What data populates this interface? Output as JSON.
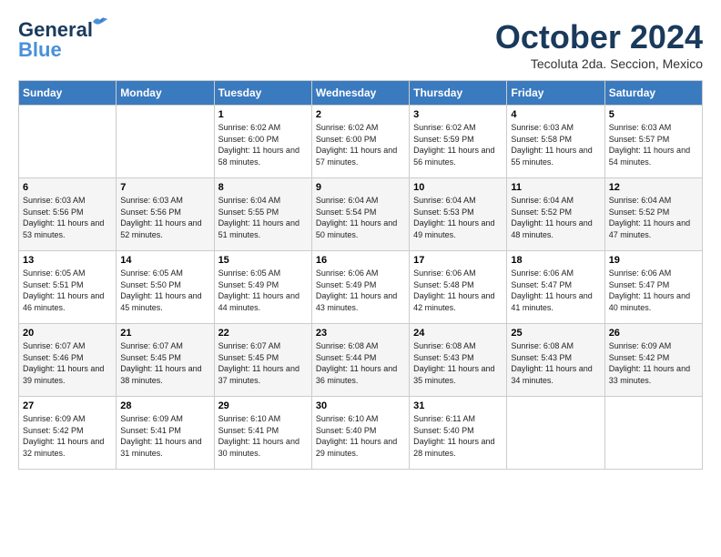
{
  "logo": {
    "general": "General",
    "blue": "Blue"
  },
  "title": "October 2024",
  "location": "Tecoluta 2da. Seccion, Mexico",
  "days_of_week": [
    "Sunday",
    "Monday",
    "Tuesday",
    "Wednesday",
    "Thursday",
    "Friday",
    "Saturday"
  ],
  "weeks": [
    [
      {
        "day": "",
        "sunrise": "",
        "sunset": "",
        "daylight": ""
      },
      {
        "day": "",
        "sunrise": "",
        "sunset": "",
        "daylight": ""
      },
      {
        "day": "1",
        "sunrise": "Sunrise: 6:02 AM",
        "sunset": "Sunset: 6:00 PM",
        "daylight": "Daylight: 11 hours and 58 minutes."
      },
      {
        "day": "2",
        "sunrise": "Sunrise: 6:02 AM",
        "sunset": "Sunset: 6:00 PM",
        "daylight": "Daylight: 11 hours and 57 minutes."
      },
      {
        "day": "3",
        "sunrise": "Sunrise: 6:02 AM",
        "sunset": "Sunset: 5:59 PM",
        "daylight": "Daylight: 11 hours and 56 minutes."
      },
      {
        "day": "4",
        "sunrise": "Sunrise: 6:03 AM",
        "sunset": "Sunset: 5:58 PM",
        "daylight": "Daylight: 11 hours and 55 minutes."
      },
      {
        "day": "5",
        "sunrise": "Sunrise: 6:03 AM",
        "sunset": "Sunset: 5:57 PM",
        "daylight": "Daylight: 11 hours and 54 minutes."
      }
    ],
    [
      {
        "day": "6",
        "sunrise": "Sunrise: 6:03 AM",
        "sunset": "Sunset: 5:56 PM",
        "daylight": "Daylight: 11 hours and 53 minutes."
      },
      {
        "day": "7",
        "sunrise": "Sunrise: 6:03 AM",
        "sunset": "Sunset: 5:56 PM",
        "daylight": "Daylight: 11 hours and 52 minutes."
      },
      {
        "day": "8",
        "sunrise": "Sunrise: 6:04 AM",
        "sunset": "Sunset: 5:55 PM",
        "daylight": "Daylight: 11 hours and 51 minutes."
      },
      {
        "day": "9",
        "sunrise": "Sunrise: 6:04 AM",
        "sunset": "Sunset: 5:54 PM",
        "daylight": "Daylight: 11 hours and 50 minutes."
      },
      {
        "day": "10",
        "sunrise": "Sunrise: 6:04 AM",
        "sunset": "Sunset: 5:53 PM",
        "daylight": "Daylight: 11 hours and 49 minutes."
      },
      {
        "day": "11",
        "sunrise": "Sunrise: 6:04 AM",
        "sunset": "Sunset: 5:52 PM",
        "daylight": "Daylight: 11 hours and 48 minutes."
      },
      {
        "day": "12",
        "sunrise": "Sunrise: 6:04 AM",
        "sunset": "Sunset: 5:52 PM",
        "daylight": "Daylight: 11 hours and 47 minutes."
      }
    ],
    [
      {
        "day": "13",
        "sunrise": "Sunrise: 6:05 AM",
        "sunset": "Sunset: 5:51 PM",
        "daylight": "Daylight: 11 hours and 46 minutes."
      },
      {
        "day": "14",
        "sunrise": "Sunrise: 6:05 AM",
        "sunset": "Sunset: 5:50 PM",
        "daylight": "Daylight: 11 hours and 45 minutes."
      },
      {
        "day": "15",
        "sunrise": "Sunrise: 6:05 AM",
        "sunset": "Sunset: 5:49 PM",
        "daylight": "Daylight: 11 hours and 44 minutes."
      },
      {
        "day": "16",
        "sunrise": "Sunrise: 6:06 AM",
        "sunset": "Sunset: 5:49 PM",
        "daylight": "Daylight: 11 hours and 43 minutes."
      },
      {
        "day": "17",
        "sunrise": "Sunrise: 6:06 AM",
        "sunset": "Sunset: 5:48 PM",
        "daylight": "Daylight: 11 hours and 42 minutes."
      },
      {
        "day": "18",
        "sunrise": "Sunrise: 6:06 AM",
        "sunset": "Sunset: 5:47 PM",
        "daylight": "Daylight: 11 hours and 41 minutes."
      },
      {
        "day": "19",
        "sunrise": "Sunrise: 6:06 AM",
        "sunset": "Sunset: 5:47 PM",
        "daylight": "Daylight: 11 hours and 40 minutes."
      }
    ],
    [
      {
        "day": "20",
        "sunrise": "Sunrise: 6:07 AM",
        "sunset": "Sunset: 5:46 PM",
        "daylight": "Daylight: 11 hours and 39 minutes."
      },
      {
        "day": "21",
        "sunrise": "Sunrise: 6:07 AM",
        "sunset": "Sunset: 5:45 PM",
        "daylight": "Daylight: 11 hours and 38 minutes."
      },
      {
        "day": "22",
        "sunrise": "Sunrise: 6:07 AM",
        "sunset": "Sunset: 5:45 PM",
        "daylight": "Daylight: 11 hours and 37 minutes."
      },
      {
        "day": "23",
        "sunrise": "Sunrise: 6:08 AM",
        "sunset": "Sunset: 5:44 PM",
        "daylight": "Daylight: 11 hours and 36 minutes."
      },
      {
        "day": "24",
        "sunrise": "Sunrise: 6:08 AM",
        "sunset": "Sunset: 5:43 PM",
        "daylight": "Daylight: 11 hours and 35 minutes."
      },
      {
        "day": "25",
        "sunrise": "Sunrise: 6:08 AM",
        "sunset": "Sunset: 5:43 PM",
        "daylight": "Daylight: 11 hours and 34 minutes."
      },
      {
        "day": "26",
        "sunrise": "Sunrise: 6:09 AM",
        "sunset": "Sunset: 5:42 PM",
        "daylight": "Daylight: 11 hours and 33 minutes."
      }
    ],
    [
      {
        "day": "27",
        "sunrise": "Sunrise: 6:09 AM",
        "sunset": "Sunset: 5:42 PM",
        "daylight": "Daylight: 11 hours and 32 minutes."
      },
      {
        "day": "28",
        "sunrise": "Sunrise: 6:09 AM",
        "sunset": "Sunset: 5:41 PM",
        "daylight": "Daylight: 11 hours and 31 minutes."
      },
      {
        "day": "29",
        "sunrise": "Sunrise: 6:10 AM",
        "sunset": "Sunset: 5:41 PM",
        "daylight": "Daylight: 11 hours and 30 minutes."
      },
      {
        "day": "30",
        "sunrise": "Sunrise: 6:10 AM",
        "sunset": "Sunset: 5:40 PM",
        "daylight": "Daylight: 11 hours and 29 minutes."
      },
      {
        "day": "31",
        "sunrise": "Sunrise: 6:11 AM",
        "sunset": "Sunset: 5:40 PM",
        "daylight": "Daylight: 11 hours and 28 minutes."
      },
      {
        "day": "",
        "sunrise": "",
        "sunset": "",
        "daylight": ""
      },
      {
        "day": "",
        "sunrise": "",
        "sunset": "",
        "daylight": ""
      }
    ]
  ]
}
